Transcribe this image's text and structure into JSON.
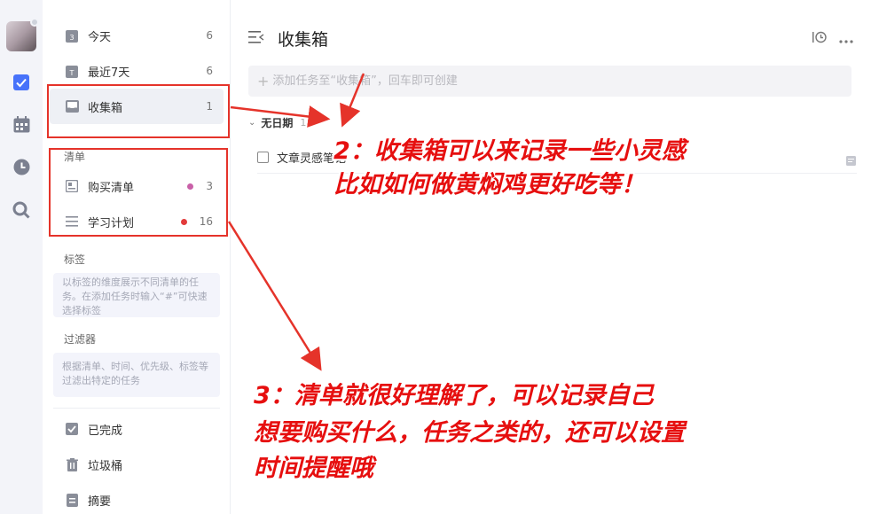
{
  "sidebar": {
    "smart_lists": [
      {
        "label": "今天",
        "count": "6",
        "icon": "calendar-day-icon"
      },
      {
        "label": "最近7天",
        "count": "6",
        "icon": "calendar-week-icon"
      },
      {
        "label": "收集箱",
        "count": "1",
        "icon": "inbox-icon"
      }
    ],
    "lists_title": "清单",
    "lists": [
      {
        "label": "购买清单",
        "count": "3",
        "icon": "board-list-icon",
        "dot_color": "#c960a8"
      },
      {
        "label": "学习计划",
        "count": "16",
        "icon": "list-lines-icon",
        "dot_color": "#e23b3b"
      }
    ],
    "tags_title": "标签",
    "tags_tip": "以标签的维度展示不同清单的任务。在添加任务时输入“#”可快速选择标签",
    "filters_title": "过滤器",
    "filters_tip": "根据清单、时间、优先级、标签等过滤出特定的任务",
    "bottom": [
      {
        "label": "已完成",
        "icon": "check-square-icon"
      },
      {
        "label": "垃圾桶",
        "icon": "trash-icon"
      },
      {
        "label": "摘要",
        "icon": "summary-icon"
      }
    ]
  },
  "rail": {
    "icons": [
      "task-check-icon",
      "calendar-icon",
      "clock-icon",
      "search-icon"
    ],
    "accent": "#4772fa"
  },
  "main": {
    "title": "收集箱",
    "add_placeholder": "添加任务至“收集箱”，回车即可创建",
    "group": {
      "name": "无日期",
      "count": "1"
    },
    "tasks": [
      {
        "title": "文章灵感笔记"
      }
    ]
  },
  "annotations": {
    "a2_line1": "2：收集箱可以来记录一些小灵感",
    "a2_line2": "比如如何做黄焖鸡更好吃等！",
    "a3_line1": "3：清单就很好理解了，可以记录自己",
    "a3_line2": "想要购买什么，任务之类的，还可以设置",
    "a3_line3": "时间提醒哦",
    "color": "#e60f0f"
  }
}
